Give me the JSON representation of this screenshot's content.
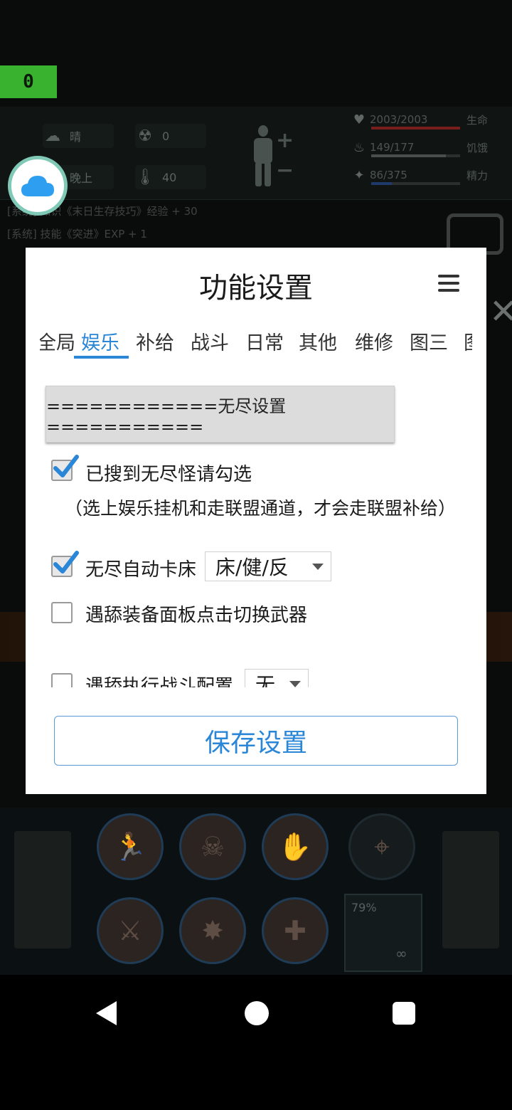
{
  "overlay": {
    "counter": "0"
  },
  "game_hud": {
    "weather": "晴",
    "radiation": "0",
    "time_of_day": "晚上",
    "temperature": "40",
    "stats": [
      {
        "value": "2003/2003",
        "label": "生命",
        "icon": "heart-icon",
        "fill": 1.0,
        "color": "#7a1d1d"
      },
      {
        "value": "149/177",
        "label": "饥饿",
        "icon": "food-icon",
        "fill": 0.84,
        "color": "#4a4f4d"
      },
      {
        "value": "86/375",
        "label": "精力",
        "icon": "energy-icon",
        "fill": 0.23,
        "color": "#1d3a6b"
      }
    ],
    "log_lines": [
      "[系统] 知识《末日生存技巧》经验 + 30",
      "[系统] 技能《突进》EXP + 1"
    ],
    "weapon_durability": "79%",
    "weapon_ammo": "∞"
  },
  "dialog": {
    "title": "功能设置",
    "tabs": [
      "全局",
      "娱乐",
      "补给",
      "战斗",
      "日常",
      "其他",
      "维修",
      "图三",
      "图"
    ],
    "active_tab": "娱乐",
    "section_header": "============无尽设置===========",
    "options": [
      {
        "label": "已搜到无尽怪请勾选",
        "checked": true
      },
      {
        "label": "无尽自动卡床",
        "checked": true,
        "dropdown": "床/健/反"
      },
      {
        "label": "遇舔装备面板点击切换武器",
        "checked": false
      },
      {
        "label": "遇舔执行战斗配置",
        "checked": false,
        "dropdown": "无"
      }
    ],
    "note": "（选上娱乐挂机和走联盟通道，才会走联盟补给）",
    "save_label": "保存设置"
  },
  "colors": {
    "accent": "#2a86d6",
    "counter_bg": "#39b32f",
    "cloud_ring": "#7fc9b6",
    "cloud_icon": "#2e9ff0"
  }
}
